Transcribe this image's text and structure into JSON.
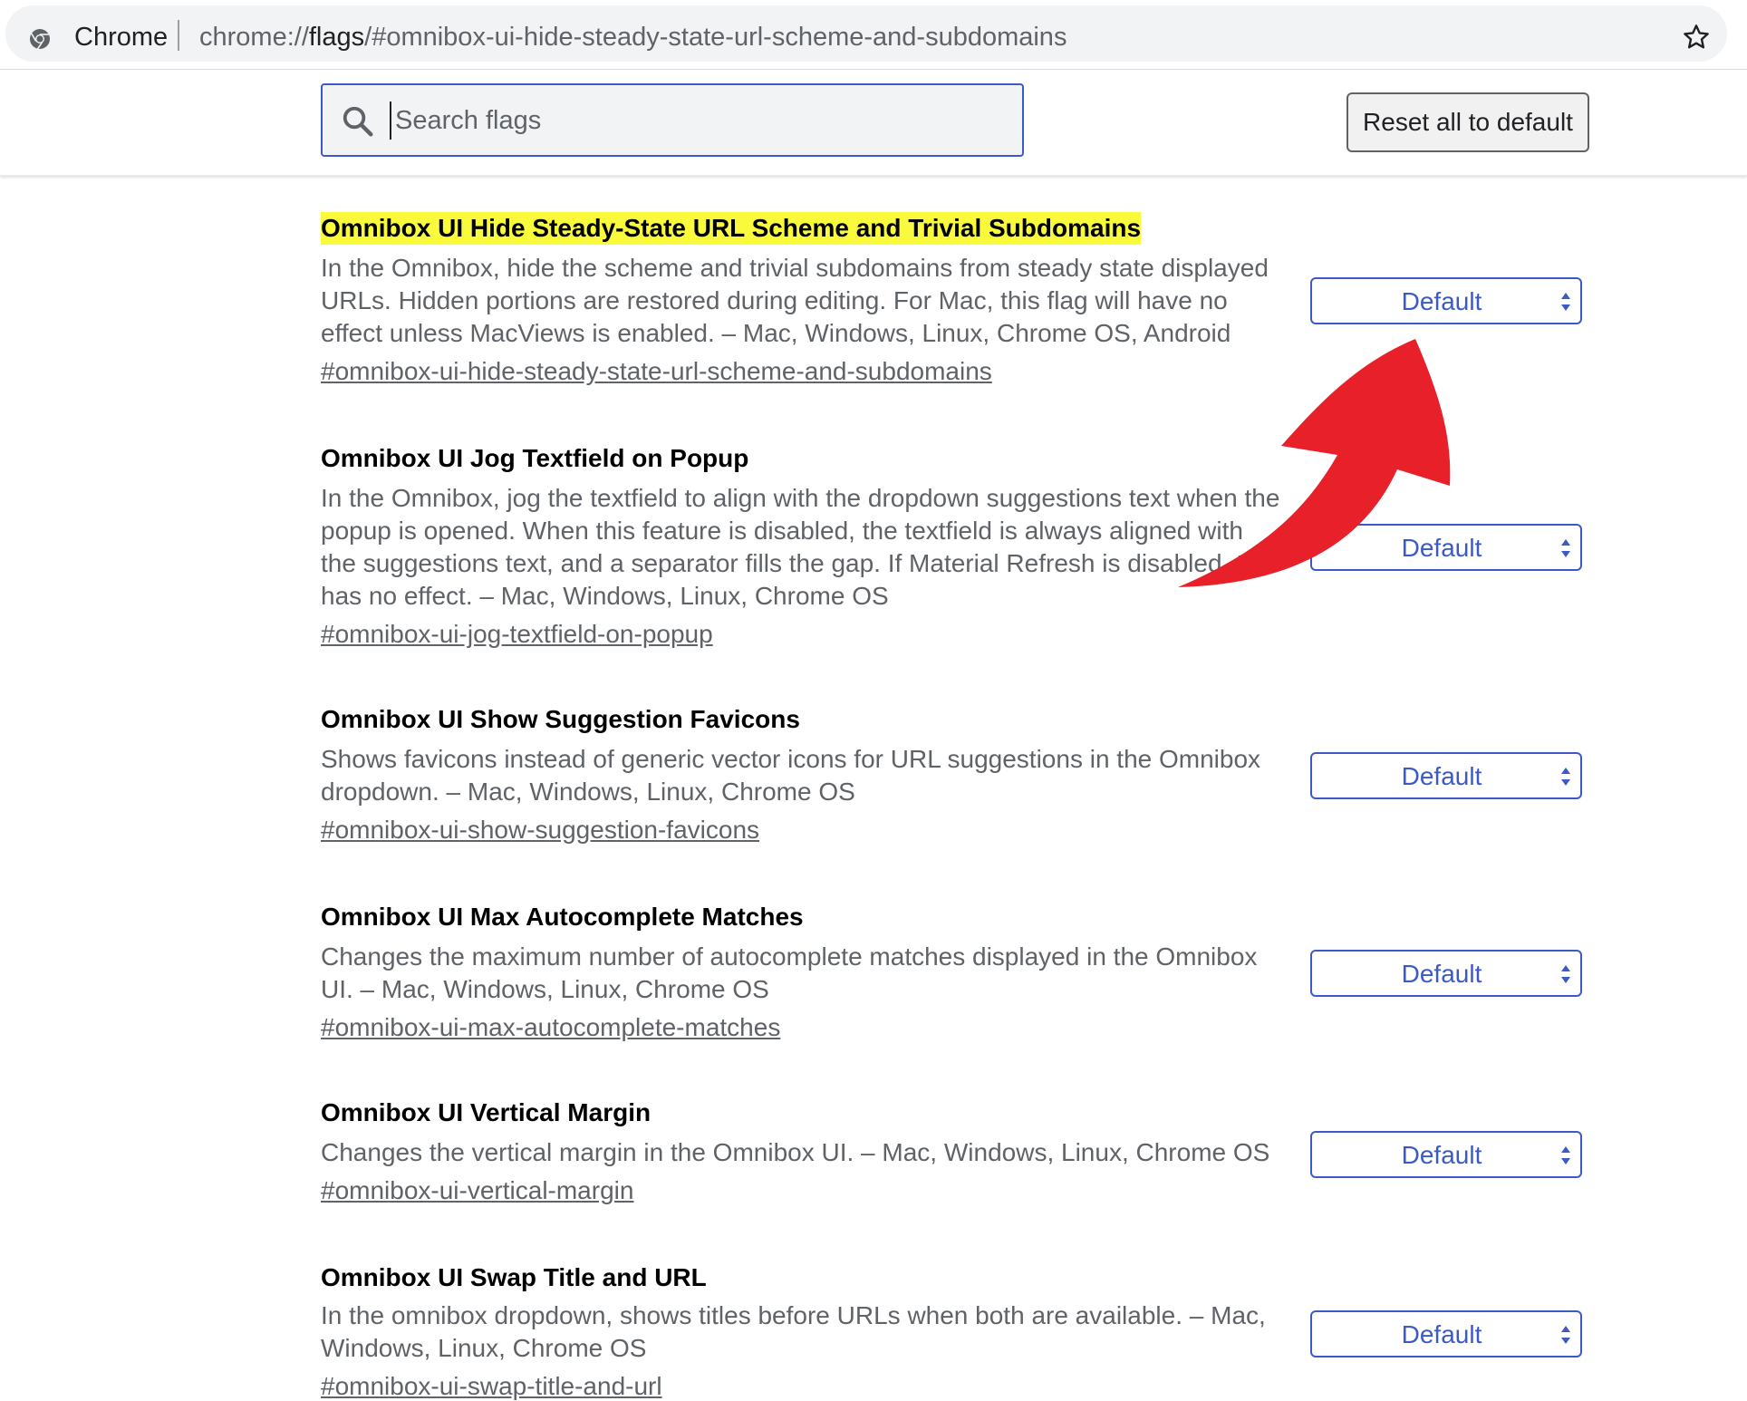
{
  "browser": {
    "site_chip": "Chrome",
    "url_prefix": "chrome://",
    "url_host": "flags",
    "url_path": "/#omnibox-ui-hide-steady-state-url-scheme-and-subdomains"
  },
  "toolbar": {
    "search_placeholder": "Search flags",
    "search_value": "",
    "reset_label": "Reset all to default"
  },
  "colors": {
    "accent": "#3c59c8",
    "highlight": "#fafa3c",
    "annotation_arrow": "#e8202a"
  },
  "experiments": [
    {
      "title": "Omnibox UI Hide Steady-State URL Scheme and Trivial Subdomains",
      "description": "In the Omnibox, hide the scheme and trivial subdomains from steady state displayed URLs. Hidden portions are restored during editing. For Mac, this flag will have no effect unless MacViews is enabled. – Mac, Windows, Linux, Chrome OS, Android",
      "link": "#omnibox-ui-hide-steady-state-url-scheme-and-subdomains",
      "value": "Default",
      "highlighted": true
    },
    {
      "title": "Omnibox UI Jog Textfield on Popup",
      "description": "In the Omnibox, jog the textfield to align with the dropdown suggestions text when the popup is opened. When this feature is disabled, the textfield is always aligned with the suggestions text, and a separator fills the gap. If Material Refresh is disabled, this has no effect. – Mac, Windows, Linux, Chrome OS",
      "link": "#omnibox-ui-jog-textfield-on-popup",
      "value": "Default"
    },
    {
      "title": "Omnibox UI Show Suggestion Favicons",
      "description": "Shows favicons instead of generic vector icons for URL suggestions in the Omnibox dropdown. – Mac, Windows, Linux, Chrome OS",
      "link": "#omnibox-ui-show-suggestion-favicons",
      "value": "Default"
    },
    {
      "title": "Omnibox UI Max Autocomplete Matches",
      "description": "Changes the maximum number of autocomplete matches displayed in the Omnibox UI. – Mac, Windows, Linux, Chrome OS",
      "link": "#omnibox-ui-max-autocomplete-matches",
      "value": "Default"
    },
    {
      "title": "Omnibox UI Vertical Margin",
      "description": "Changes the vertical margin in the Omnibox UI. – Mac, Windows, Linux, Chrome OS",
      "link": "#omnibox-ui-vertical-margin",
      "value": "Default"
    },
    {
      "title": "Omnibox UI Swap Title and URL",
      "description": "In the omnibox dropdown, shows titles before URLs when both are available. – Mac, Windows, Linux, Chrome OS",
      "link": "#omnibox-ui-swap-title-and-url",
      "value": "Default"
    }
  ]
}
